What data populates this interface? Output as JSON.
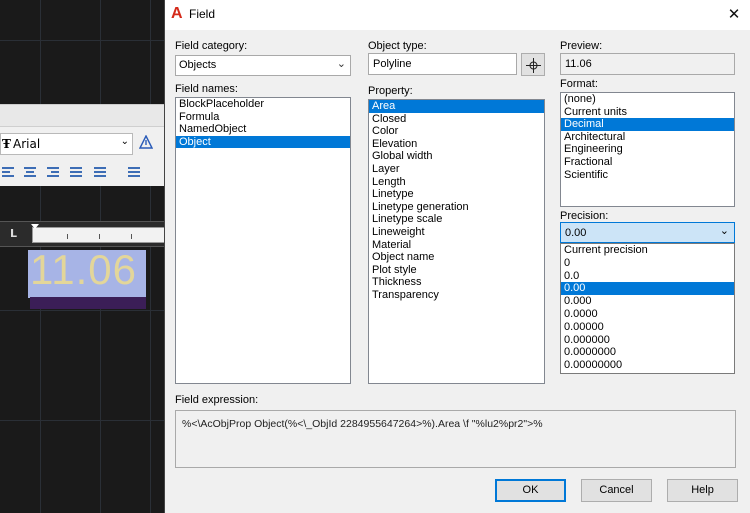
{
  "background": {
    "font_name": "Arial",
    "preview_text": "11.06"
  },
  "dialog": {
    "title": "Field",
    "close_glyph": "✕",
    "field_category": {
      "label": "Field category:",
      "value": "Objects"
    },
    "field_names": {
      "label": "Field names:",
      "items": [
        "BlockPlaceholder",
        "Formula",
        "NamedObject",
        "Object"
      ],
      "selected_index": 3
    },
    "object_type": {
      "label": "Object type:",
      "value": "Polyline"
    },
    "property": {
      "label": "Property:",
      "items": [
        "Area",
        "Closed",
        "Color",
        "Elevation",
        "Global width",
        "Layer",
        "Length",
        "Linetype",
        "Linetype generation",
        "Linetype scale",
        "Lineweight",
        "Material",
        "Object name",
        "Plot style",
        "Thickness",
        "Transparency"
      ],
      "selected_index": 0
    },
    "preview": {
      "label": "Preview:",
      "value": "11.06"
    },
    "format": {
      "label": "Format:",
      "items": [
        "(none)",
        "Current units",
        "Decimal",
        "Architectural",
        "Engineering",
        "Fractional",
        "Scientific"
      ],
      "selected_index": 2
    },
    "precision": {
      "label": "Precision:",
      "value": "0.00",
      "items": [
        "Current precision",
        "0",
        "0.0",
        "0.00",
        "0.000",
        "0.0000",
        "0.00000",
        "0.000000",
        "0.0000000",
        "0.00000000"
      ],
      "selected_index": 3
    },
    "field_expression": {
      "label": "Field expression:",
      "value": "%<\\AcObjProp Object(%<\\_ObjId 2284955647264>%).Area \\f \"%lu2%pr2\">%"
    },
    "buttons": {
      "ok": "OK",
      "cancel": "Cancel",
      "help": "Help"
    }
  },
  "colors": {
    "selection": "#0078d7",
    "title_icon": "#d42a1a",
    "preview_text": "#e3d69a",
    "preview_highlight": "#a7b4e6"
  }
}
